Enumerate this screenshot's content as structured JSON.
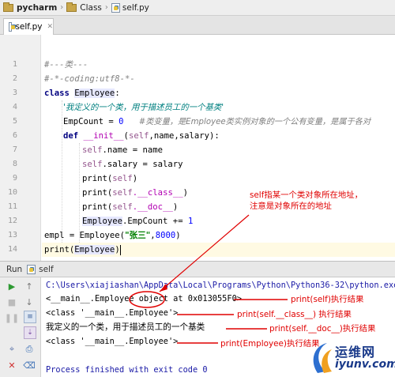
{
  "breadcrumb": {
    "project": "pycharm",
    "folder": "Class",
    "file": "self.py"
  },
  "tabs": [
    {
      "label": "self.py"
    }
  ],
  "editor": {
    "line_numbers": [
      "1",
      "2",
      "3",
      "4",
      "5",
      "6",
      "7",
      "8",
      "9",
      "10",
      "11",
      "12",
      "13",
      "14"
    ],
    "lines": {
      "l1": "#---类---",
      "l2": "#-*-coding:utf8-*-",
      "l3_kw": "class ",
      "l3_name": "Employee",
      "l3_tail": ":",
      "l4": "'我定义的一个类，用于描述员工的一个基类'",
      "l5_code": "EmpCount = ",
      "l5_num": "0",
      "l5_comment": "#类变量，是Employee类实例对象的一个公有变量，是属于各对",
      "l6_kw": "def ",
      "l6_name": "__init__",
      "l6_open": "(",
      "l6_self": "self",
      "l6_args": ",name,salary):",
      "l7_self": "self",
      "l7_rest": ".name = name",
      "l8_self": "self",
      "l8_rest": ".salary = salary",
      "l9_fn": "print(",
      "l9_self": "self",
      "l9_close": ")",
      "l10_fn": "print(",
      "l10_self": "self",
      "l10_magic": ".__class__",
      "l10_close": ")",
      "l11_fn": "print(",
      "l11_self": "self",
      "l11_magic": ".__doc__",
      "l11_close": ")",
      "l12_name": "Employee",
      "l12_rest": ".EmpCount += ",
      "l12_num": "1",
      "l13_pre": "empl = Employee(",
      "l13_str": "\"张三\"",
      "l13_mid": ",",
      "l13_num": "8000",
      "l13_end": ")",
      "l14_pre": "print(",
      "l14_name": "Employee",
      "l14_end": ")"
    }
  },
  "run": {
    "label": "Run",
    "config": "self",
    "console": [
      "C:\\Users\\xiajiashan\\AppData\\Local\\Programs\\Python\\Python36-32\\python.exe G",
      "<__main__.Employee object at 0x013055F0>",
      "<class '__main__.Employee'>",
      "我定义的一个类，用于描述员工的一个基类",
      "<class '__main__.Employee'>",
      "",
      "Process finished with exit code 0"
    ]
  },
  "annotations": {
    "note": "self指某一个类对象所在地址，注意是对象所在的地址",
    "a1": "print(self)执行结果",
    "a2": "print(self.__class__)  执行结果",
    "a3": "print(self.__doc__)执行结果",
    "a4": "print(Employee)执行结果"
  },
  "watermark": {
    "cn": "运维网",
    "url": "iyunv.com"
  },
  "colors": {
    "annotation": "#e00000",
    "keyword": "#000080",
    "string": "#008080",
    "comment": "#808080",
    "self": "#94558d"
  },
  "icons": [
    "folder-icon",
    "python-file-icon",
    "run-icon",
    "stop-icon",
    "rerun-icon",
    "pause-icon",
    "print-icon",
    "close-icon",
    "pin-icon",
    "scroll-icon"
  ]
}
